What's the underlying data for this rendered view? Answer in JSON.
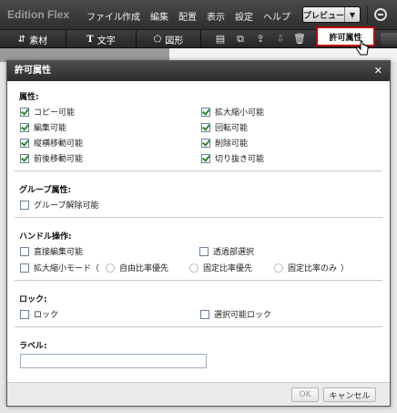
{
  "app": {
    "name": "Edition Flex"
  },
  "menu": [
    "ファイル",
    "作成",
    "編集",
    "配置",
    "表示",
    "設定",
    "ヘルプ"
  ],
  "preview_label": "プレビュー",
  "toolbar": {
    "material_label": "素材",
    "text_label": "文字",
    "shape_label": "図形",
    "perm_label": "許可属性"
  },
  "dialog": {
    "title": "許可属性",
    "attributes": {
      "title": "属性:",
      "items": [
        {
          "label": "コピー可能",
          "checked": true
        },
        {
          "label": "拡大縮小可能",
          "checked": true
        },
        {
          "label": "編集可能",
          "checked": true
        },
        {
          "label": "回転可能",
          "checked": true
        },
        {
          "label": "縦横移動可能",
          "checked": true
        },
        {
          "label": "削除可能",
          "checked": true
        },
        {
          "label": "前後移動可能",
          "checked": true
        },
        {
          "label": "切り抜き可能",
          "checked": true
        }
      ]
    },
    "group": {
      "title": "グループ属性:",
      "items": [
        {
          "label": "グループ解除可能",
          "checked": false
        }
      ]
    },
    "handle": {
      "title": "ハンドル操作:",
      "direct_edit": "直接編集可能",
      "transparent": "透過部選択",
      "scale_mode": "拡大縮小モード（",
      "modes": [
        "自由比率優先",
        "固定比率優先",
        "固定比率のみ"
      ],
      "close_paren": "）"
    },
    "lock": {
      "title": "ロック:",
      "lock_label": "ロック",
      "select_lock": "選択可能ロック"
    },
    "label": {
      "title": "ラベル:",
      "value": ""
    },
    "ok_label": "OK",
    "cancel_label": "キャンセル"
  }
}
